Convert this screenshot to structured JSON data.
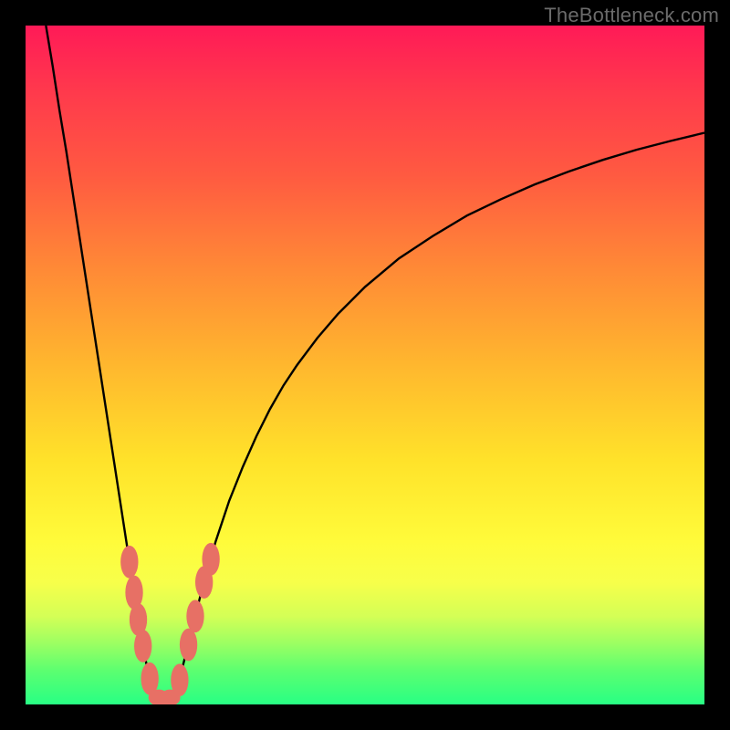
{
  "watermark": "TheBottleneck.com",
  "colors": {
    "frame": "#000000",
    "gradient_top": "#ff1a57",
    "gradient_bottom": "#28ff84",
    "curve": "#000000",
    "marker": "#e77065"
  },
  "chart_data": {
    "type": "line",
    "title": "",
    "xlabel": "",
    "ylabel": "",
    "xlim": [
      0,
      100
    ],
    "ylim": [
      0,
      100
    ],
    "grid": false,
    "series": [
      {
        "name": "curve",
        "x": [
          3.0,
          4.0,
          5.0,
          6.0,
          7.0,
          8.0,
          9.0,
          10.0,
          11.0,
          12.0,
          13.0,
          14.0,
          15.0,
          16.0,
          17.0,
          18.0,
          19.0,
          20.0,
          21.0,
          22.0,
          23.0,
          24.0,
          25.0,
          26.0,
          27.0,
          28.0,
          30.0,
          32.0,
          34.0,
          36.0,
          38.0,
          40.0,
          43.0,
          46.0,
          50.0,
          55.0,
          60.0,
          65.0,
          70.0,
          75.0,
          80.0,
          85.0,
          90.0,
          95.0,
          100.0
        ],
        "y": [
          100.0,
          94.0,
          87.5,
          81.5,
          75.0,
          68.5,
          62.0,
          55.5,
          49.0,
          42.5,
          36.0,
          29.5,
          23.0,
          16.5,
          10.0,
          5.0,
          2.0,
          0.6,
          0.6,
          2.0,
          5.0,
          9.0,
          13.0,
          17.0,
          20.5,
          24.0,
          30.0,
          35.0,
          39.5,
          43.5,
          47.0,
          50.0,
          54.0,
          57.5,
          61.5,
          65.7,
          69.0,
          72.0,
          74.4,
          76.6,
          78.5,
          80.2,
          81.7,
          83.0,
          84.2
        ]
      }
    ],
    "markers": [
      {
        "x": 15.3,
        "y": 21.0,
        "rx": 1.3,
        "ry": 2.4
      },
      {
        "x": 16.0,
        "y": 16.5,
        "rx": 1.3,
        "ry": 2.5
      },
      {
        "x": 16.6,
        "y": 12.5,
        "rx": 1.3,
        "ry": 2.4
      },
      {
        "x": 17.3,
        "y": 8.6,
        "rx": 1.3,
        "ry": 2.4
      },
      {
        "x": 18.3,
        "y": 3.8,
        "rx": 1.3,
        "ry": 2.4
      },
      {
        "x": 19.6,
        "y": 1.0,
        "rx": 1.5,
        "ry": 1.2
      },
      {
        "x": 21.3,
        "y": 1.0,
        "rx": 1.5,
        "ry": 1.2
      },
      {
        "x": 22.7,
        "y": 3.6,
        "rx": 1.3,
        "ry": 2.4
      },
      {
        "x": 24.0,
        "y": 8.8,
        "rx": 1.3,
        "ry": 2.4
      },
      {
        "x": 25.0,
        "y": 13.0,
        "rx": 1.3,
        "ry": 2.4
      },
      {
        "x": 26.3,
        "y": 18.0,
        "rx": 1.3,
        "ry": 2.4
      },
      {
        "x": 27.3,
        "y": 21.4,
        "rx": 1.3,
        "ry": 2.4
      }
    ]
  }
}
